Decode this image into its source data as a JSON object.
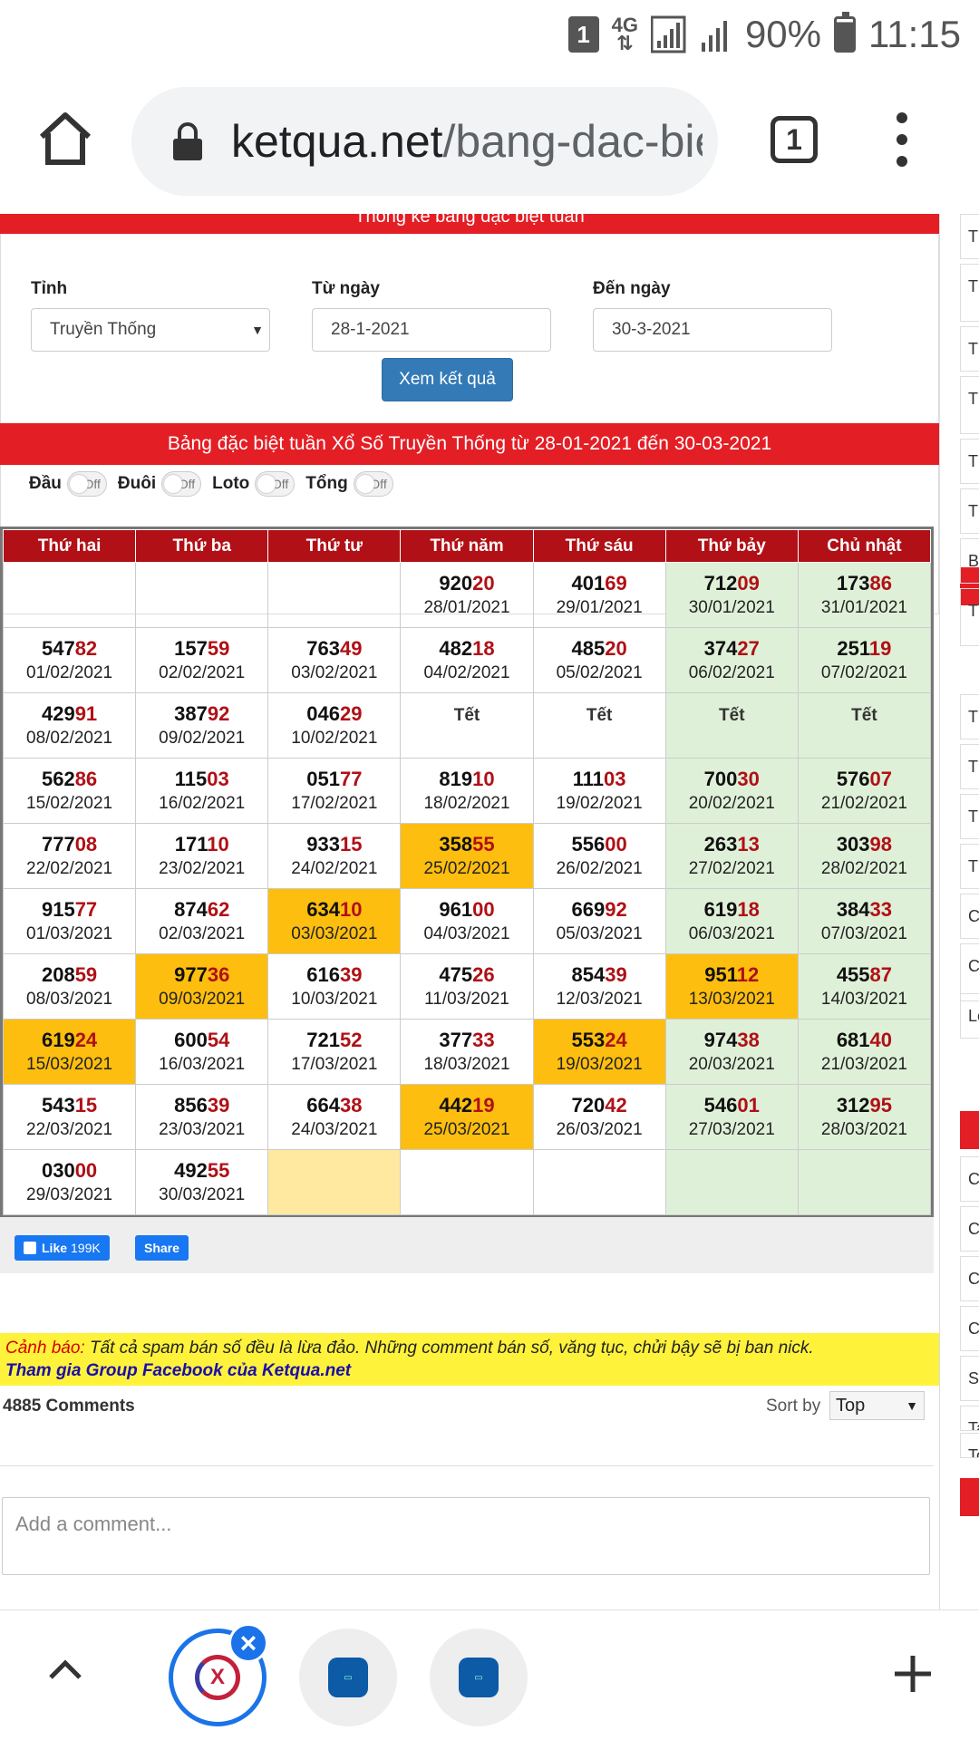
{
  "status": {
    "sim": "1",
    "network": "4G",
    "battery": "90%",
    "time": "11:15"
  },
  "browser": {
    "url_host": "ketqua.net",
    "url_path": "/bang-dac-bie",
    "tab_count": "1"
  },
  "page": {
    "top_banner": "Thống kê bảng đặc biệt tuần",
    "filter": {
      "province_label": "Tỉnh",
      "province_value": "Truyền Thống",
      "from_label": "Từ ngày",
      "from_value": "28-1-2021",
      "to_label": "Đến ngày",
      "to_value": "30-3-2021",
      "submit_label": "Xem kết quả"
    },
    "table_title": "Bảng đặc biệt tuần Xổ Số Truyền Thống từ 28-01-2021 đến 30-03-2021",
    "toggles": [
      {
        "label": "Đầu",
        "state": "Off"
      },
      {
        "label": "Đuôi",
        "state": "Off"
      },
      {
        "label": "Loto",
        "state": "Off"
      },
      {
        "label": "Tổng",
        "state": "Off"
      }
    ],
    "days": [
      "Thứ hai",
      "Thứ ba",
      "Thứ tư",
      "Thứ năm",
      "Thứ sáu",
      "Thứ bảy",
      "Chủ nhật"
    ],
    "rows": [
      [
        {
          "head": "",
          "tail": "",
          "date": ""
        },
        {
          "head": "",
          "tail": "",
          "date": ""
        },
        {
          "head": "",
          "tail": "",
          "date": ""
        },
        {
          "head": "920",
          "tail": "20",
          "date": "28/01/2021"
        },
        {
          "head": "401",
          "tail": "69",
          "date": "29/01/2021"
        },
        {
          "head": "712",
          "tail": "09",
          "date": "30/01/2021"
        },
        {
          "head": "173",
          "tail": "86",
          "date": "31/01/2021"
        }
      ],
      [
        {
          "head": "547",
          "tail": "82",
          "date": "01/02/2021"
        },
        {
          "head": "157",
          "tail": "59",
          "date": "02/02/2021"
        },
        {
          "head": "763",
          "tail": "49",
          "date": "03/02/2021"
        },
        {
          "head": "482",
          "tail": "18",
          "date": "04/02/2021"
        },
        {
          "head": "485",
          "tail": "20",
          "date": "05/02/2021"
        },
        {
          "head": "374",
          "tail": "27",
          "date": "06/02/2021"
        },
        {
          "head": "251",
          "tail": "19",
          "date": "07/02/2021"
        }
      ],
      [
        {
          "head": "429",
          "tail": "91",
          "date": "08/02/2021"
        },
        {
          "head": "387",
          "tail": "92",
          "date": "09/02/2021"
        },
        {
          "head": "046",
          "tail": "29",
          "date": "10/02/2021"
        },
        {
          "tet": "Tết"
        },
        {
          "tet": "Tết"
        },
        {
          "tet": "Tết"
        },
        {
          "tet": "Tết"
        }
      ],
      [
        {
          "head": "562",
          "tail": "86",
          "date": "15/02/2021"
        },
        {
          "head": "115",
          "tail": "03",
          "date": "16/02/2021"
        },
        {
          "head": "051",
          "tail": "77",
          "date": "17/02/2021"
        },
        {
          "head": "819",
          "tail": "10",
          "date": "18/02/2021"
        },
        {
          "head": "111",
          "tail": "03",
          "date": "19/02/2021"
        },
        {
          "head": "700",
          "tail": "30",
          "date": "20/02/2021"
        },
        {
          "head": "576",
          "tail": "07",
          "date": "21/02/2021"
        }
      ],
      [
        {
          "head": "777",
          "tail": "08",
          "date": "22/02/2021"
        },
        {
          "head": "171",
          "tail": "10",
          "date": "23/02/2021"
        },
        {
          "head": "933",
          "tail": "15",
          "date": "24/02/2021"
        },
        {
          "head": "358",
          "tail": "55",
          "date": "25/02/2021",
          "hl": true
        },
        {
          "head": "556",
          "tail": "00",
          "date": "26/02/2021"
        },
        {
          "head": "263",
          "tail": "13",
          "date": "27/02/2021"
        },
        {
          "head": "303",
          "tail": "98",
          "date": "28/02/2021"
        }
      ],
      [
        {
          "head": "915",
          "tail": "77",
          "date": "01/03/2021"
        },
        {
          "head": "874",
          "tail": "62",
          "date": "02/03/2021"
        },
        {
          "head": "634",
          "tail": "10",
          "date": "03/03/2021",
          "hl": true
        },
        {
          "head": "961",
          "tail": "00",
          "date": "04/03/2021"
        },
        {
          "head": "669",
          "tail": "92",
          "date": "05/03/2021"
        },
        {
          "head": "619",
          "tail": "18",
          "date": "06/03/2021"
        },
        {
          "head": "384",
          "tail": "33",
          "date": "07/03/2021"
        }
      ],
      [
        {
          "head": "208",
          "tail": "59",
          "date": "08/03/2021"
        },
        {
          "head": "977",
          "tail": "36",
          "date": "09/03/2021",
          "hl": true
        },
        {
          "head": "616",
          "tail": "39",
          "date": "10/03/2021"
        },
        {
          "head": "475",
          "tail": "26",
          "date": "11/03/2021"
        },
        {
          "head": "854",
          "tail": "39",
          "date": "12/03/2021"
        },
        {
          "head": "951",
          "tail": "12",
          "date": "13/03/2021",
          "hl": true
        },
        {
          "head": "455",
          "tail": "87",
          "date": "14/03/2021"
        }
      ],
      [
        {
          "head": "619",
          "tail": "24",
          "date": "15/03/2021",
          "hl": true
        },
        {
          "head": "600",
          "tail": "54",
          "date": "16/03/2021"
        },
        {
          "head": "721",
          "tail": "52",
          "date": "17/03/2021"
        },
        {
          "head": "377",
          "tail": "33",
          "date": "18/03/2021"
        },
        {
          "head": "553",
          "tail": "24",
          "date": "19/03/2021",
          "hl": true
        },
        {
          "head": "974",
          "tail": "38",
          "date": "20/03/2021"
        },
        {
          "head": "681",
          "tail": "40",
          "date": "21/03/2021"
        }
      ],
      [
        {
          "head": "543",
          "tail": "15",
          "date": "22/03/2021"
        },
        {
          "head": "856",
          "tail": "39",
          "date": "23/03/2021"
        },
        {
          "head": "664",
          "tail": "38",
          "date": "24/03/2021"
        },
        {
          "head": "442",
          "tail": "19",
          "date": "25/03/2021",
          "hl": true
        },
        {
          "head": "720",
          "tail": "42",
          "date": "26/03/2021"
        },
        {
          "head": "546",
          "tail": "01",
          "date": "27/03/2021"
        },
        {
          "head": "312",
          "tail": "95",
          "date": "28/03/2021"
        }
      ],
      [
        {
          "head": "030",
          "tail": "00",
          "date": "29/03/2021"
        },
        {
          "head": "492",
          "tail": "55",
          "date": "30/03/2021"
        },
        {
          "head": "",
          "tail": "",
          "date": "",
          "pale": true
        },
        {
          "head": "",
          "tail": "",
          "date": ""
        },
        {
          "head": "",
          "tail": "",
          "date": ""
        },
        {
          "head": "",
          "tail": "",
          "date": ""
        },
        {
          "head": "",
          "tail": "",
          "date": ""
        }
      ]
    ],
    "facebook": {
      "like_label": "Like",
      "like_count": "199K",
      "share_label": "Share"
    },
    "warning": {
      "label": "Cảnh báo:",
      "text": " Tất cả spam bán số đều là lừa đảo. Những comment bán số, văng tục, chửi bậy sẽ bị ban nick.",
      "link": "Tham gia Group Facebook của Ketqua.net"
    },
    "comments": {
      "count": "4885 Comments",
      "sort_label": "Sort by",
      "sort_value": "Top",
      "placeholder": "Add a comment..."
    }
  },
  "right_col": [
    "Th",
    "Th lo",
    "Th",
    "Th lo",
    "Th",
    "Th",
    "Ba",
    "Th th",
    "Th",
    "Th",
    "Th",
    "Th",
    "Cu",
    "Cu Vi",
    "Lo",
    "Ch",
    "Ch",
    "Ch",
    "Ch",
    "Sc",
    "Ta",
    "To"
  ],
  "colors": {
    "red": "#e41e25",
    "dark_red": "#b01016",
    "weekend": "#dff0d8",
    "highlight": "#fdbe0f",
    "button": "#337ab7"
  }
}
